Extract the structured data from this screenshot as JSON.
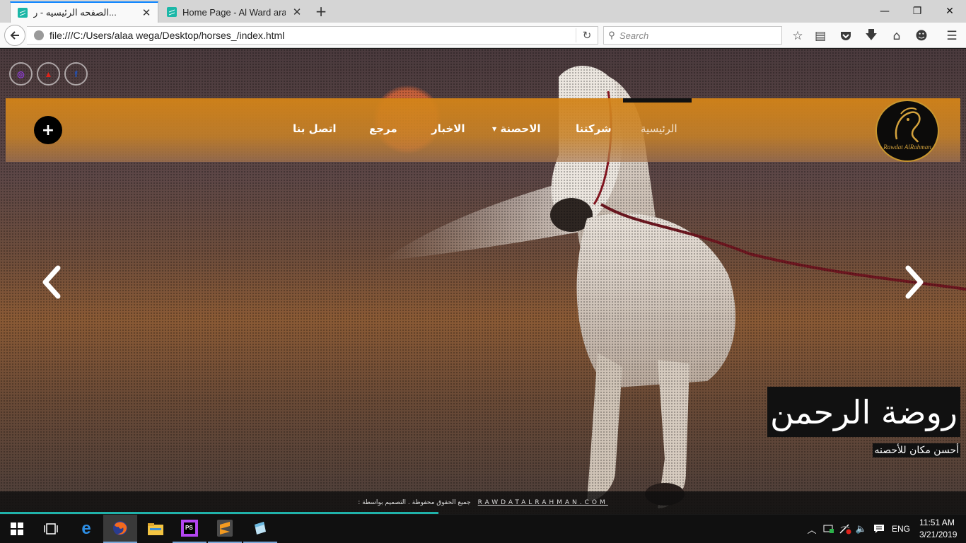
{
  "browser": {
    "tabs": [
      {
        "title": "الصفحه الرئيسيه - ر...",
        "active": true
      },
      {
        "title": "Home Page - Al Ward ara...",
        "active": false
      }
    ],
    "url": "file:///C:/Users/alaa wega/Desktop/horses_/index.html",
    "search_placeholder": "Search",
    "toolbar_icons": [
      "bookmark-star-icon",
      "reader-view-icon",
      "pocket-icon",
      "downloads-icon",
      "home-icon",
      "account-icon",
      "menu-icon"
    ]
  },
  "site": {
    "social": [
      {
        "name": "instagram-icon",
        "glyph": "◎",
        "color": "#8e3bd6"
      },
      {
        "name": "youtube-icon",
        "glyph": "▲",
        "color": "#e0231a"
      },
      {
        "name": "facebook-icon",
        "glyph": "f",
        "color": "#1e56c8"
      }
    ],
    "nav": {
      "home": "الرئيسية",
      "company": "شركتنا",
      "horses": "الاحصنة",
      "news": "الاخبار",
      "reference": "مرجع",
      "contact": "اتصل بنا"
    },
    "logo_text": "Rawdat AlRahman",
    "hero": {
      "title": "روضة الرحمن",
      "subtitle": "أحسن مكان للأحصنه"
    },
    "footer": {
      "rights": "جميع الحقوق محفوظة . التصميم بواسطة :",
      "credit": "RAWDATALRAHMAN.COM"
    }
  },
  "taskbar": {
    "apps": [
      "start-icon",
      "task-view-icon",
      "edge-icon",
      "firefox-icon",
      "file-explorer-icon",
      "phpstorm-icon",
      "sublime-text-icon",
      "notepad-icon"
    ],
    "language": "ENG",
    "time": "11:51 AM",
    "date": "3/21/2019"
  }
}
